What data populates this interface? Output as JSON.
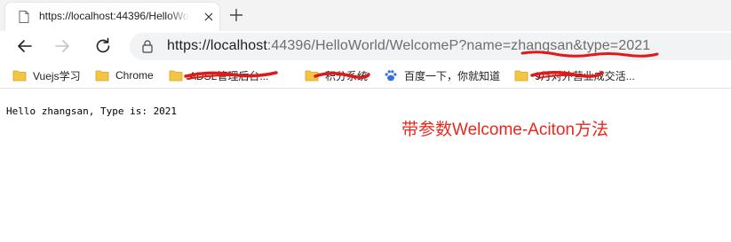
{
  "tab": {
    "title": "https://localhost:44396/HelloWo",
    "favicon": "page-icon",
    "close_icon": "close-icon",
    "new_tab_icon": "plus-icon"
  },
  "toolbar": {
    "back_icon": "back-arrow-icon",
    "forward_icon": "forward-arrow-icon",
    "refresh_icon": "refresh-icon",
    "lock_icon": "lock-icon",
    "url_scheme_host": "https://localhost",
    "url_rest": ":44396/HelloWorld/WelcomeP?name=zhangsan&type=2021"
  },
  "bookmarks": [
    {
      "label": "Vuejs学习",
      "icon": "folder-icon"
    },
    {
      "label": "Chrome",
      "icon": "folder-icon"
    },
    {
      "label": "ADSL管理后台...",
      "icon": "folder-icon"
    },
    {
      "label": "积分系统",
      "icon": "folder-icon"
    },
    {
      "label": "百度一下，你就知道",
      "icon": "baidu-paw-icon"
    },
    {
      "label": "9月对外营业成交活...",
      "icon": "folder-icon"
    }
  ],
  "page": {
    "output_text": "Hello zhangsan, Type is: 2021"
  },
  "annotation": {
    "text": "带参数Welcome-Aciton方法",
    "color": "#e8281c"
  },
  "colors": {
    "tabstrip_bg": "#f3f3f3",
    "address_bg": "#f1f3f4",
    "folder_yellow": "#f4c542",
    "scribble_red": "#e01919"
  }
}
